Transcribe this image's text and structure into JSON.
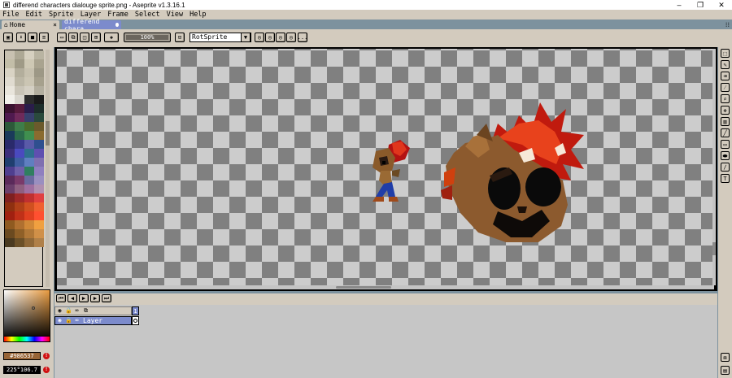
{
  "window": {
    "title": "differend characters dialouge sprite.png - Aseprite v1.3.16.1",
    "minimize": "–",
    "maximize": "❐",
    "close": "✕"
  },
  "menu": [
    "File",
    "Edit",
    "Sprite",
    "Layer",
    "Frame",
    "Select",
    "View",
    "Help"
  ],
  "tabs": [
    {
      "label": "Home",
      "close": "×"
    },
    {
      "label": "differend chara"
    }
  ],
  "context_bar": {
    "slider_value": "100%",
    "rotation_algorithm": "RotSprite",
    "more": "..."
  },
  "colors": {
    "fg_hex": "#986537",
    "fg_color": "#986537",
    "bg_value": "225°106.7",
    "accent": "#7c8bcc",
    "panel": "#d3cbbe",
    "background": "#7d929e"
  },
  "palette": [
    "#c8c1b1",
    "#ada895",
    "#d6d0c0",
    "#b9b4a2",
    "#c3bea8",
    "#9f9a86",
    "#cec8b4",
    "#a9a38f",
    "#d9d3c4",
    "#b3ae9c",
    "#c6c0ae",
    "#9d9886",
    "#e0dbd0",
    "#bcb7a6",
    "#cbc5b3",
    "#a6a08d",
    "#e9e5dc",
    "#c9c4b7",
    "#d4cfc3",
    "#b2ad9e",
    "#f2f0ea",
    "#d8d5cd",
    "#2c2c2c",
    "#1a1a1a",
    "#3b1230",
    "#571b3d",
    "#2a1d4a",
    "#1d2d2a",
    "#4f1a4f",
    "#6f2a5a",
    "#38406d",
    "#2a4a3c",
    "#2d5a3a",
    "#3e7d4a",
    "#4a6b2c",
    "#6b5a2c",
    "#1a3a5a",
    "#2b6b4b",
    "#3f8f4f",
    "#8a6b2f",
    "#2a2a6b",
    "#3a3a8f",
    "#5a5aa8",
    "#2f4f8f",
    "#3b2f7b",
    "#4a4abf",
    "#2f6f8f",
    "#5f4fb0",
    "#1f3f6f",
    "#3f5fa0",
    "#5f7fc0",
    "#7f6fb0",
    "#4f3f8f",
    "#6f5fa8",
    "#2f7f5f",
    "#8f7fbf",
    "#5a2a5a",
    "#7a3a6a",
    "#6a6a9f",
    "#9a8fc0",
    "#6b3f6b",
    "#8f5f7f",
    "#a06fa0",
    "#b090b0",
    "#7f2020",
    "#a02828",
    "#c03030",
    "#e04040",
    "#8f3010",
    "#b04018",
    "#d05020",
    "#f06030",
    "#a02010",
    "#c03018",
    "#e04020",
    "#ff5030",
    "#8f5a20",
    "#b07030",
    "#d08838",
    "#f0a040",
    "#6b4a20",
    "#8f6028",
    "#b07838",
    "#d09048",
    "#4a3a20",
    "#6b5028",
    "#8f6838",
    "#b08048"
  ],
  "timeline": {
    "frame_number": "1",
    "layer_name": "Layer"
  },
  "icons": {
    "home": "⌂",
    "menu_grip": "⁝⁝",
    "text_tool": "T"
  }
}
